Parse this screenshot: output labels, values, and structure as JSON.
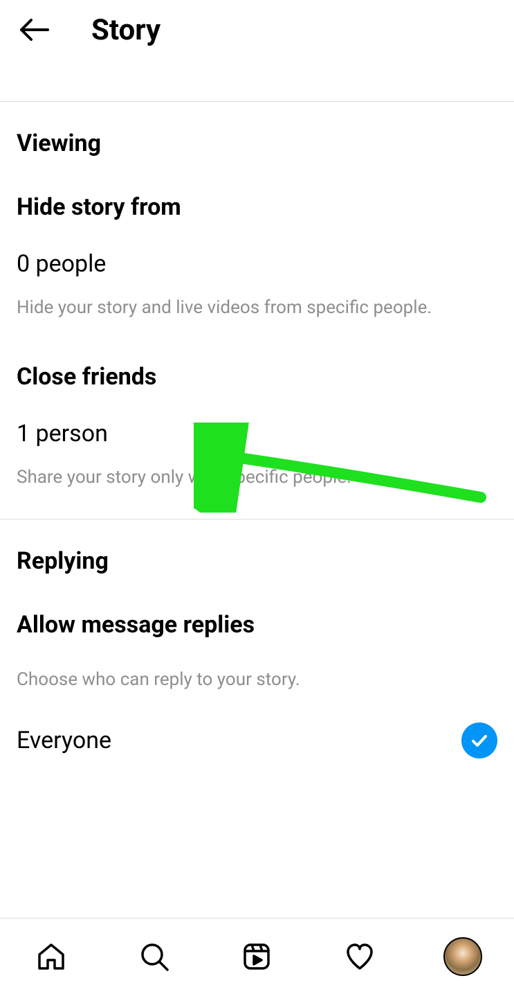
{
  "header": {
    "title": "Story"
  },
  "viewing": {
    "heading": "Viewing",
    "hide_title": "Hide story from",
    "hide_value": "0 people",
    "hide_desc": "Hide your story and live videos from specific people.",
    "close_title": "Close friends",
    "close_value": "1 person",
    "close_desc": "Share your story only with specific people."
  },
  "replying": {
    "heading": "Replying",
    "allow_title": "Allow message replies",
    "allow_desc": "Choose who can reply to your story.",
    "option_everyone": "Everyone"
  }
}
